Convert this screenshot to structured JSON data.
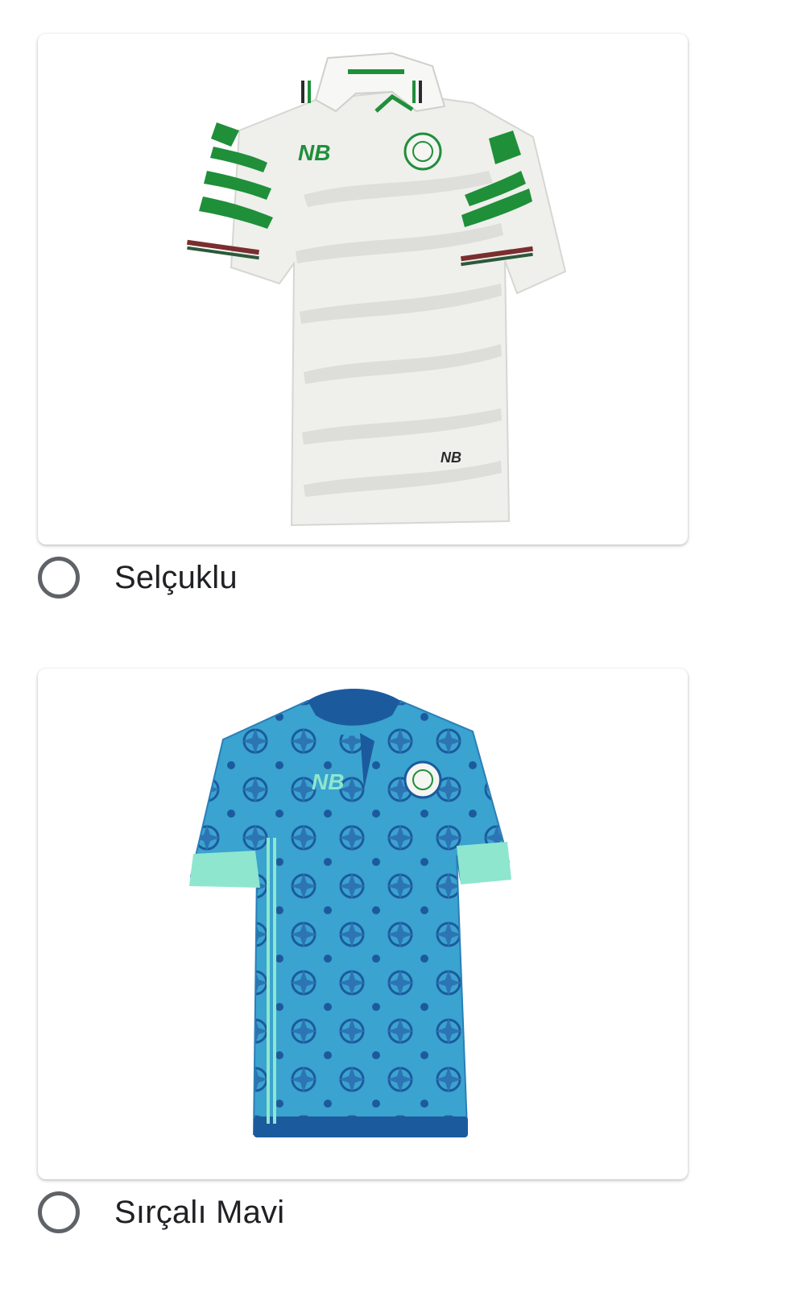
{
  "options": [
    {
      "label": "Selçuklu",
      "image_desc_icon": "white-green-jersey-image",
      "selected": false,
      "colors": {
        "base": "#efefec",
        "accent": "#1f8f3a"
      }
    },
    {
      "label": "Sırçalı Mavi",
      "image_desc_icon": "blue-pattern-jersey-image",
      "selected": false,
      "colors": {
        "base": "#3aa3cf",
        "accent": "#1c5a9e",
        "trim": "#8ee6cf"
      }
    }
  ]
}
